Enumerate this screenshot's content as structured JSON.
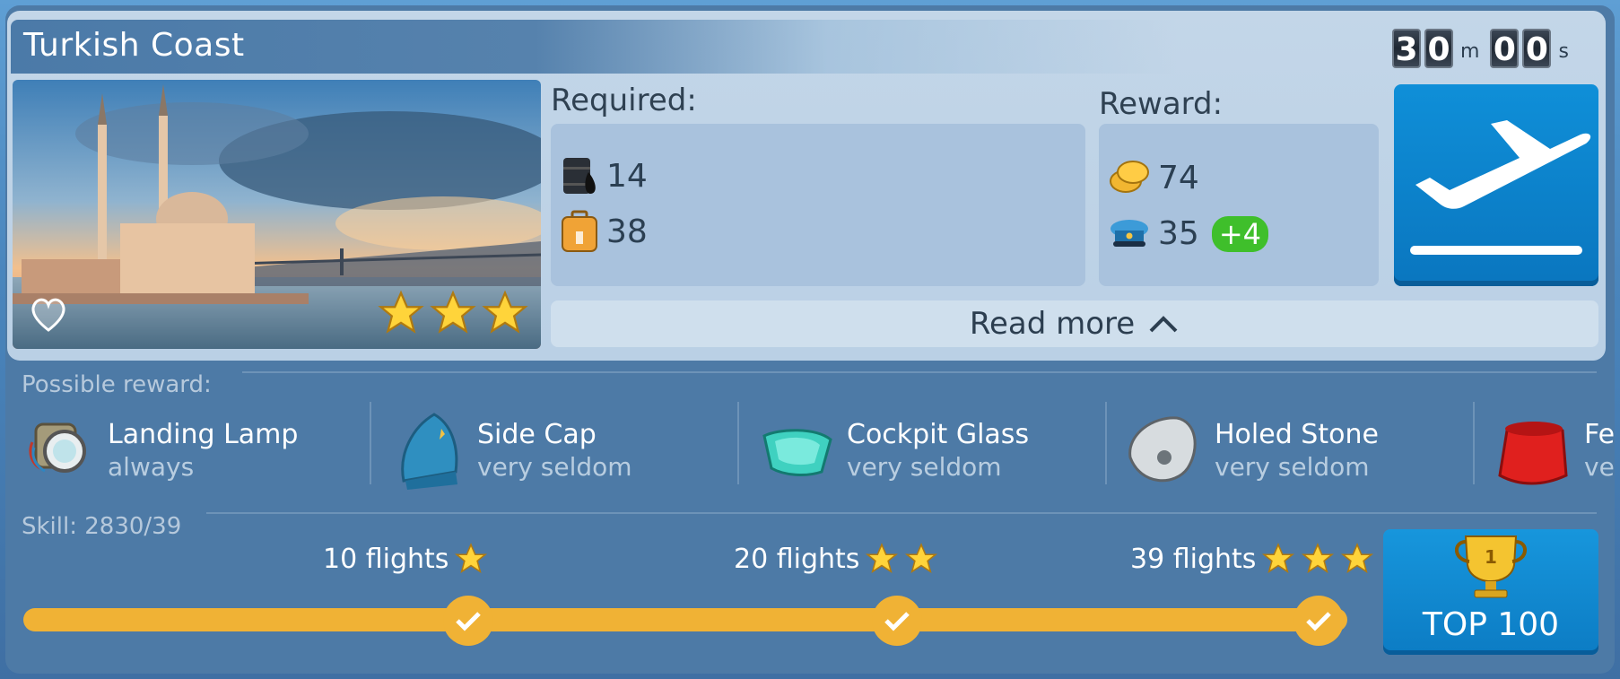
{
  "mission": {
    "title": "Turkish Coast",
    "timer": {
      "minutes": [
        "3",
        "0"
      ],
      "seconds": [
        "0",
        "0"
      ],
      "m_unit": "m",
      "s_unit": "s"
    },
    "stars": 3,
    "required_label": "Required:",
    "reward_label": "Reward:",
    "required": [
      {
        "icon": "fuel-barrel-icon",
        "value": "14"
      },
      {
        "icon": "luggage-icon",
        "value": "38"
      }
    ],
    "reward": [
      {
        "icon": "coins-icon",
        "value": "74"
      },
      {
        "icon": "pilot-cap-icon",
        "value": "35",
        "bonus": "+4"
      }
    ],
    "read_more": "Read more"
  },
  "possible_reward": {
    "label": "Possible reward:",
    "items": [
      {
        "name": "Landing Lamp",
        "freq": "always",
        "icon": "landing-lamp-icon"
      },
      {
        "name": "Side Cap",
        "freq": "very seldom",
        "icon": "side-cap-icon"
      },
      {
        "name": "Cockpit Glass",
        "freq": "very seldom",
        "icon": "cockpit-glass-icon"
      },
      {
        "name": "Holed Stone",
        "freq": "very seldom",
        "icon": "holed-stone-icon"
      },
      {
        "name": "Fe",
        "freq": "ve",
        "icon": "fez-icon"
      }
    ]
  },
  "skill": {
    "label": "Skill: 2830/39",
    "milestones": [
      {
        "label": "10 flights",
        "stars": 1
      },
      {
        "label": "20 flights",
        "stars": 2
      },
      {
        "label": "39 flights",
        "stars": 3
      }
    ],
    "progress": 1.0
  },
  "top100": {
    "label": "TOP 100",
    "rank_badge": "1"
  },
  "colors": {
    "accent_blue": "#0f8fd8",
    "progress": "#f0b235",
    "bonus_green": "#3fbf2b"
  }
}
